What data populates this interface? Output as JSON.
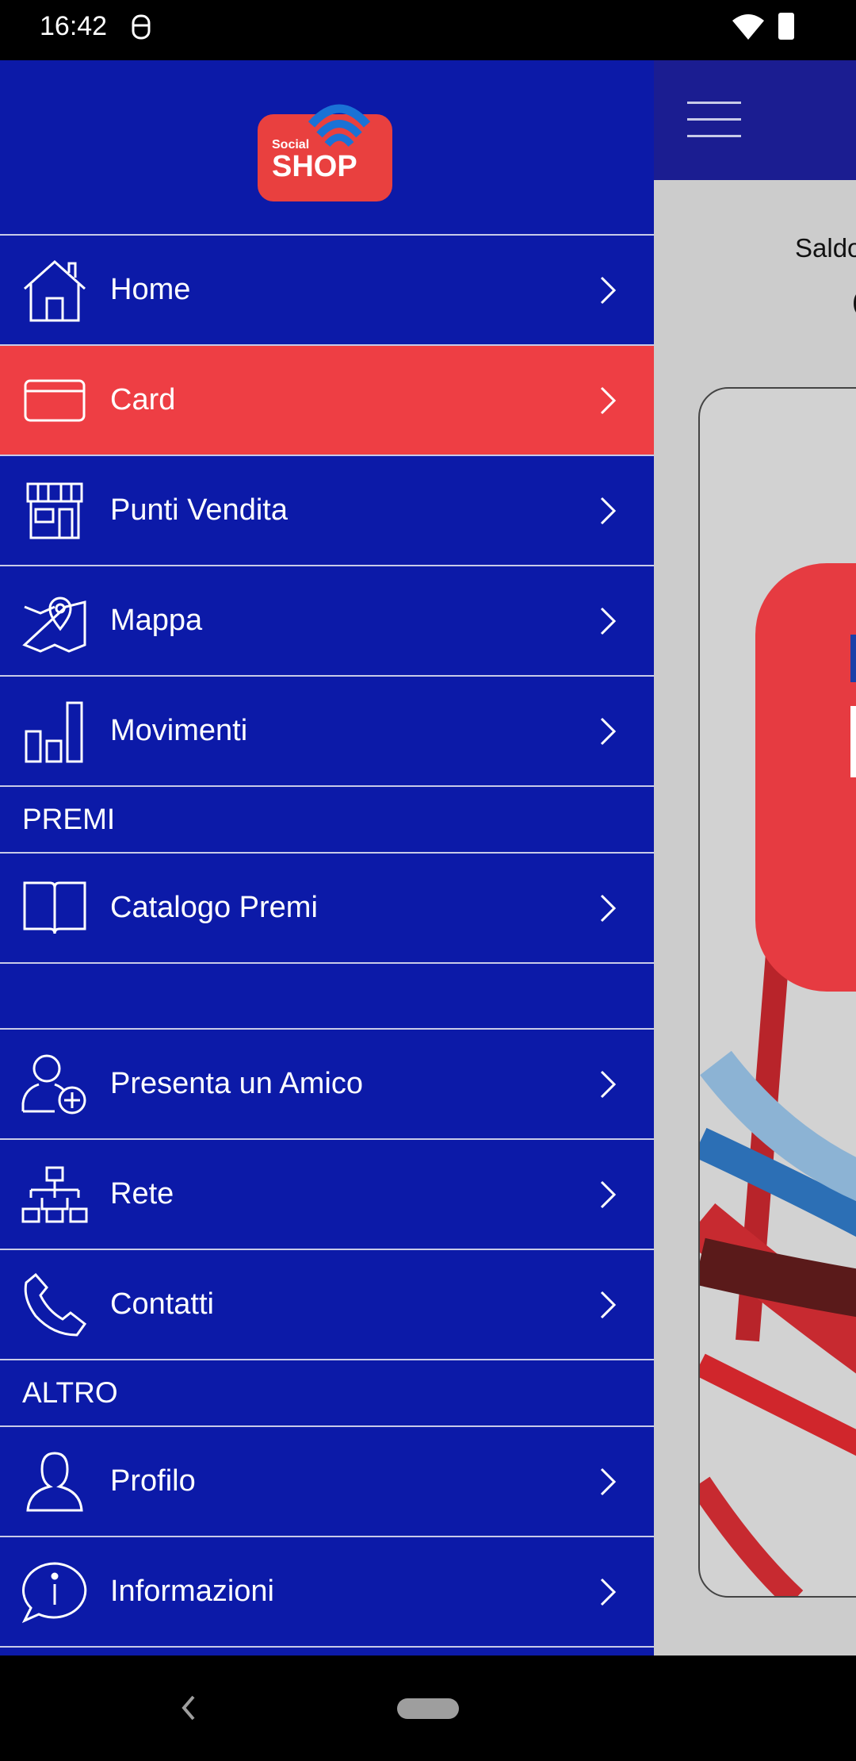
{
  "status_bar": {
    "time": "16:42"
  },
  "drawer": {
    "logo_text": {
      "small": "Social",
      "big": "SHOP"
    },
    "items": [
      {
        "label": "Home",
        "icon": "home-icon"
      },
      {
        "label": "Card",
        "icon": "credit-card-icon",
        "active": true
      },
      {
        "label": "Punti Vendita",
        "icon": "store-icon"
      },
      {
        "label": "Mappa",
        "icon": "map-pin-icon"
      },
      {
        "label": "Movimenti",
        "icon": "bar-chart-icon"
      }
    ],
    "section_premi": "PREMI",
    "premi_items": [
      {
        "label": "Catalogo Premi",
        "icon": "book-icon"
      }
    ],
    "extra_items": [
      {
        "label": "Presenta un Amico",
        "icon": "add-user-icon"
      },
      {
        "label": "Rete",
        "icon": "network-icon"
      },
      {
        "label": "Contatti",
        "icon": "phone-icon"
      }
    ],
    "section_altro": "ALTRO",
    "altro_items": [
      {
        "label": "Profilo",
        "icon": "user-icon"
      },
      {
        "label": "Informazioni",
        "icon": "info-icon"
      }
    ]
  },
  "main": {
    "saldo_label": "Saldo",
    "balance_partial": "("
  },
  "colors": {
    "drawer_bg": "#0c1aa8",
    "active": "#ee3e44",
    "topbar": "#1b1d91",
    "content_bg": "#cccccc"
  }
}
